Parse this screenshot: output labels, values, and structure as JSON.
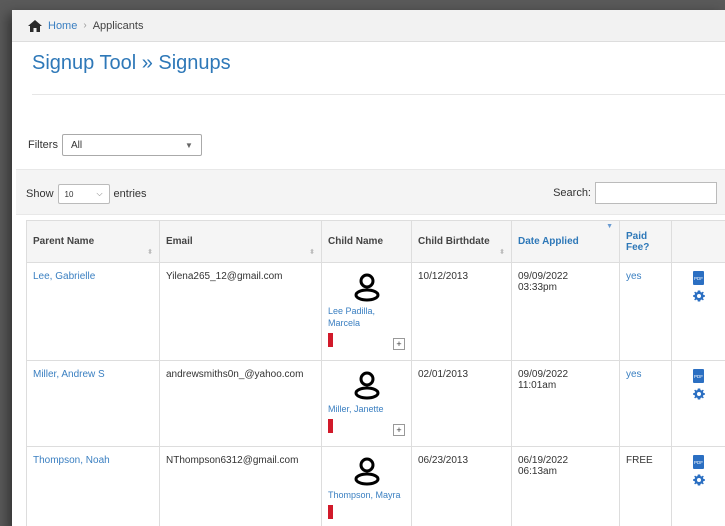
{
  "breadcrumb": {
    "home": "Home",
    "sep": "›",
    "current": "Applicants"
  },
  "page_title": "Signup Tool » Signups",
  "filters": {
    "label": "Filters",
    "value": "All"
  },
  "length": {
    "show": "Show",
    "value": "10",
    "entries": "entries"
  },
  "search": {
    "label": "Search:",
    "value": ""
  },
  "columns": {
    "parent": "Parent Name",
    "email": "Email",
    "child": "Child Name",
    "birth": "Child Birthdate",
    "applied": "Date Applied",
    "paid": "Paid Fee?"
  },
  "rows": [
    {
      "parent": "Lee, Gabrielle",
      "email": "Yilena265_12@gmail.com",
      "child": "Lee Padilla, Marcela",
      "birth": "10/12/2013",
      "applied_date": "09/09/2022",
      "applied_time": "03:33pm",
      "paid": "yes"
    },
    {
      "parent": "Miller, Andrew S",
      "email": "andrewsmiths0n_@yahoo.com",
      "child": "Miller, Janette",
      "birth": "02/01/2013",
      "applied_date": "09/09/2022",
      "applied_time": "11:01am",
      "paid": "yes"
    },
    {
      "parent": "Thompson, Noah",
      "email": "NThompson6312@gmail.com",
      "child": "Thompson, Mayra",
      "birth": "06/23/2013",
      "applied_date": "06/19/2022",
      "applied_time": "06:13am",
      "paid": "FREE"
    }
  ],
  "icons": {
    "pdf_text": "PDF",
    "plus": "+"
  },
  "colors": {
    "link": "#3a7fc1",
    "flag": "#d11a2a",
    "title": "#2e78b8"
  }
}
